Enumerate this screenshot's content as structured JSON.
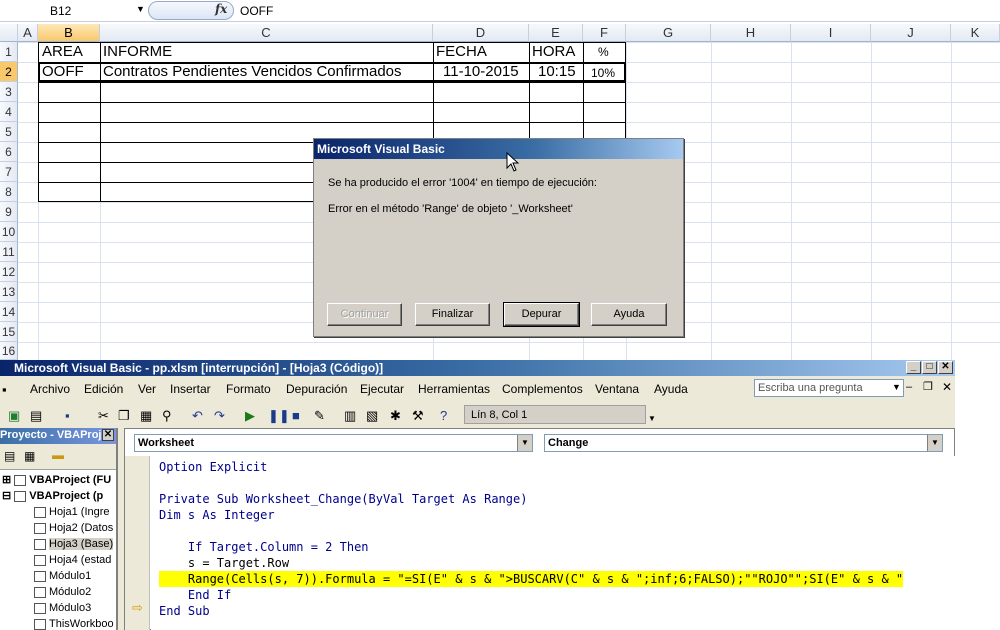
{
  "formula_bar": {
    "name_box": "B12",
    "fx": "fx",
    "value": "OOFF"
  },
  "columns": [
    "A",
    "B",
    "C",
    "D",
    "E",
    "F",
    "G",
    "H",
    "I",
    "J",
    "K"
  ],
  "rows": [
    "1",
    "2",
    "3",
    "4",
    "5",
    "6",
    "7",
    "8",
    "9",
    "10",
    "11",
    "12",
    "13",
    "14",
    "15",
    "16"
  ],
  "table": {
    "headers": {
      "area": "AREA",
      "informe": "INFORME",
      "fecha": "FECHA",
      "hora": "HORA",
      "pct": "%"
    },
    "row2": {
      "area": "OOFF",
      "informe": "Contratos Pendientes Vencidos Confirmados",
      "fecha": "11-10-2015",
      "hora": "10:15",
      "pct": "10%"
    }
  },
  "dialog": {
    "title": "Microsoft Visual Basic",
    "message1": "Se ha producido el error '1004' en tiempo de ejecución:",
    "message2": "Error en el método 'Range' de objeto '_Worksheet'",
    "buttons": {
      "continuar": "Continuar",
      "finalizar": "Finalizar",
      "depurar": "Depurar",
      "ayuda": "Ayuda"
    }
  },
  "vbe": {
    "title": "Microsoft Visual Basic - pp.xlsm [interrupción] - [Hoja3 (Código)]",
    "menu": [
      "Archivo",
      "Edición",
      "Ver",
      "Insertar",
      "Formato",
      "Depuración",
      "Ejecutar",
      "Herramientas",
      "Complementos",
      "Ventana",
      "Ayuda"
    ],
    "ask_placeholder": "Escriba una pregunta",
    "position": "Lín 8, Col 1",
    "project_title": "Proyecto - VBAProj",
    "tree": [
      {
        "label": "VBAProject (FU"
      },
      {
        "label": "VBAProject (p"
      },
      {
        "label": "Hoja1 (Ingre"
      },
      {
        "label": "Hoja2 (Datos"
      },
      {
        "label": "Hoja3 (Base)"
      },
      {
        "label": "Hoja4 (estad"
      },
      {
        "label": "Módulo1"
      },
      {
        "label": "Módulo2"
      },
      {
        "label": "Módulo3"
      },
      {
        "label": "ThisWorkboo"
      }
    ],
    "object_combo": "Worksheet",
    "proc_combo": "Change",
    "code": [
      "Option Explicit",
      "",
      "Private Sub Worksheet_Change(ByVal Target As Range)",
      "Dim s As Integer",
      "",
      "    If Target.Column = 2 Then",
      "    s = Target.Row",
      "    Range(Cells(s, 7)).Formula = \"=SI(E\" & s & \">BUSCARV(C\" & s & \";inf;6;FALSO);\"\"ROJO\"\";SI(E\" & s & \"",
      "    End If",
      "End Sub"
    ]
  }
}
